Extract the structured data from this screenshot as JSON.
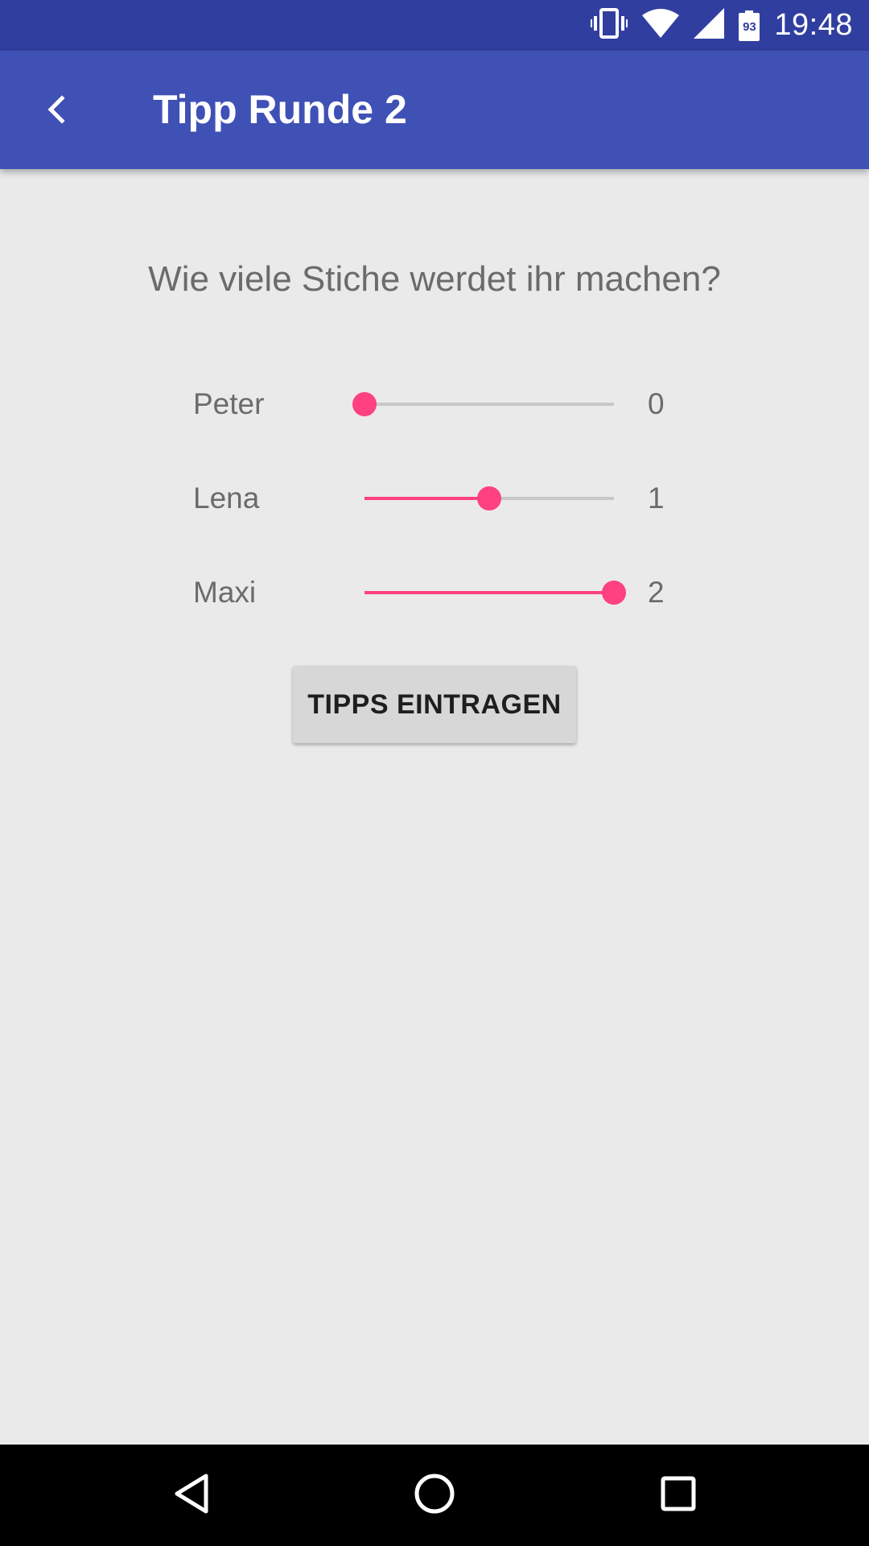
{
  "status_bar": {
    "time": "19:48",
    "battery_level": "93",
    "icons": [
      "vibrate-icon",
      "wifi-icon",
      "cell-signal-icon",
      "battery-icon"
    ]
  },
  "app_bar": {
    "title": "Tipp Runde 2",
    "back_icon": "back-arrow-icon"
  },
  "main": {
    "question": "Wie viele Stiche werdet ihr machen?",
    "slider_max": 2,
    "players": [
      {
        "name": "Peter",
        "value": "0",
        "level": 0
      },
      {
        "name": "Lena",
        "value": "1",
        "level": 1
      },
      {
        "name": "Maxi",
        "value": "2",
        "level": 2
      }
    ],
    "submit_label": "TIPPS EINTRAGEN"
  },
  "nav_bar": {
    "icons": [
      "nav-back-icon",
      "nav-home-icon",
      "nav-recents-icon"
    ]
  },
  "colors": {
    "status_bar": "#303F9F",
    "app_bar": "#3F51B5",
    "accent": "#FF4081",
    "background": "#EAEAEA"
  }
}
